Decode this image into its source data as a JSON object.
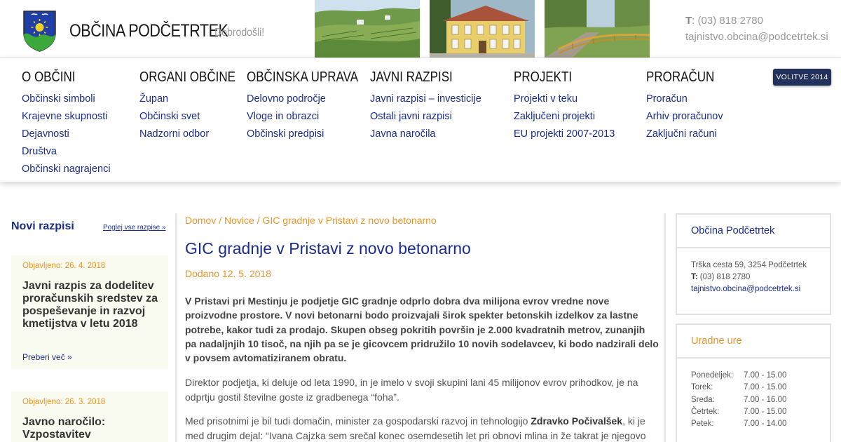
{
  "header": {
    "site_title": "OBČINA PODČETRTEK",
    "welcome": "Dobrodošli!",
    "phone_label": "T",
    "phone": ": (03) 818 2780",
    "email": "tajnistvo.obcina@podcetrtek.si"
  },
  "nav": {
    "columns": [
      {
        "heading": "O OBČINI",
        "items": [
          "Občinski simboli",
          "Krajevne skupnosti",
          "Dejavnosti",
          "Društva",
          "Občinski nagrajenci"
        ]
      },
      {
        "heading": "ORGANI OBČINE",
        "items": [
          "Župan",
          "Občinski svet",
          "Nadzorni odbor"
        ]
      },
      {
        "heading": "OBČINSKA UPRAVA",
        "items": [
          "Delovno področje",
          "Vloge in obrazci",
          "Občinski predpisi"
        ]
      },
      {
        "heading": "JAVNI RAZPISI",
        "items": [
          "Javni razpisi – investicije",
          "Ostali javni razpisi",
          "Javna naročila"
        ]
      },
      {
        "heading": "PROJEKTI",
        "items": [
          "Projekti v teku",
          "Zaključeni projekti",
          "EU projekti 2007-2013"
        ]
      },
      {
        "heading": "PRORAČUN",
        "items": [
          "Proračun",
          "Arhiv proračunov",
          "Zaključni računi"
        ]
      }
    ],
    "volitve_button": "VOLITVE 2014"
  },
  "left": {
    "title": "Novi razpisi",
    "view_all": "Poglej vse razpise »",
    "cards": [
      {
        "date": "Objavljeno: 26. 4. 2018",
        "title": "Javni razpis za dodelitev proračunskih sredstev za pospeševanje in razvoj kmetijstva v letu 2018",
        "more": "Preberi več »"
      },
      {
        "date": "Objavljeno: 26. 3. 2018",
        "title": "Javno naročilo: Vzpostavitev",
        "more": ""
      }
    ]
  },
  "main": {
    "breadcrumb": "Domov / Novice / GIC gradnje v Pristavi z novo betonarno",
    "title": "GIC gradnje v Pristavi z novo betonarno",
    "date": "Dodano 12. 5. 2018",
    "lead": "V Pristavi pri Mestinju je podjetje GIC gradnje odprlo dobra dva milijona evrov vredne nove proizvodne prostore. V novi betonarni bodo proizvajali širok spekter betonskih izdelkov za lastne potrebe, kakor tudi za prodajo. Skupen obseg pokritih površin je 2.000 kvadratnih metrov, zunanjih pa nadaljnjih 10 tisoč, na njih pa se je gicovcem pridružilo 10 novih sodelavcev, ki bodo nadzirali delo v povsem avtomatiziranem obratu.",
    "p1": "Direktor podjetja, ki deluje od leta 1990, in je imelo v svoji skupini lani 45 milijonov evrov prihodkov, je na odprtju gostil številne goste iz gradbenega “foha”.",
    "p2_start": "Med prisotnimi je bil tudi domačin, minister za gospodarski razvoj in tehnologijo ",
    "p2_bold": "Zdravko Počivalšek",
    "p2_end": ", ki je med drugim dejal: “Ivana Cajzka sem srečal konec osemdesetih let pri obnovi mlina in že takrat je njegovo"
  },
  "right": {
    "contact": {
      "title": "Občina Podčetrtek",
      "address": "Trška cesta 59, 3254 Podčetrtek",
      "phone_label": "T:",
      "phone": " (03) 818 2780",
      "email": "tajnistvo.obcina@podcetrtek.si"
    },
    "hours": {
      "title": "Uradne ure",
      "rows": [
        {
          "day": "Ponedeljek:",
          "time": "7.00 - 15.00"
        },
        {
          "day": "Torek:",
          "time": "7.00 - 15.00"
        },
        {
          "day": "Sreda:",
          "time": "7.00 - 16.00"
        },
        {
          "day": "Četrtek:",
          "time": "7.00 - 15.00"
        },
        {
          "day": "Petek:",
          "time": "7.00 - 14.00"
        }
      ]
    }
  },
  "colors": {
    "link": "#1a2d8c",
    "accent": "#e8962a",
    "volitve_bg": "#22305c"
  }
}
